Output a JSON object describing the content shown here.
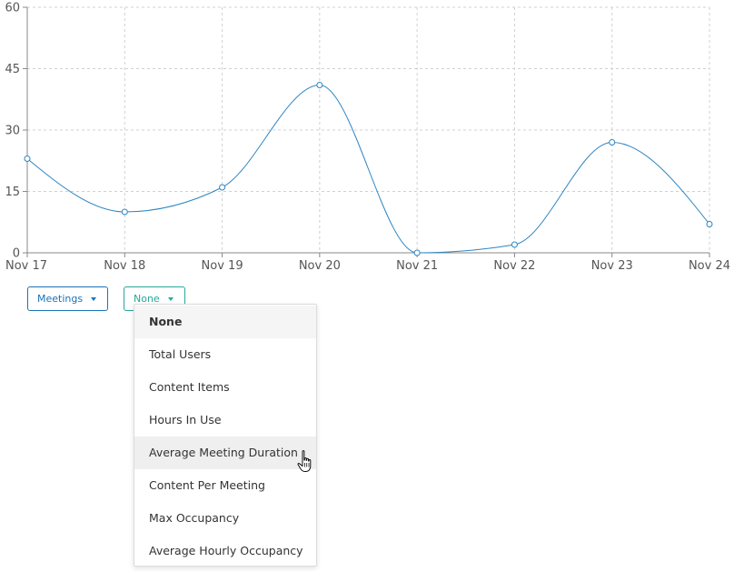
{
  "chart_data": {
    "type": "line",
    "categories": [
      "Nov 17",
      "Nov 18",
      "Nov 19",
      "Nov 20",
      "Nov 21",
      "Nov 22",
      "Nov 23",
      "Nov 24"
    ],
    "values": [
      23,
      10,
      16,
      41,
      0,
      2,
      27,
      7
    ],
    "ylim": [
      0,
      60
    ],
    "yticks": [
      "0",
      "15",
      "30",
      "45",
      "60"
    ],
    "grid": true,
    "line_color": "#2e86c1"
  },
  "controls": {
    "metric_label": "Meetings",
    "compare_label": "None"
  },
  "dropdown": {
    "items": [
      {
        "label": "None"
      },
      {
        "label": "Total Users"
      },
      {
        "label": "Content Items"
      },
      {
        "label": "Hours In Use"
      },
      {
        "label": "Average Meeting Duration"
      },
      {
        "label": "Content Per Meeting"
      },
      {
        "label": "Max Occupancy"
      },
      {
        "label": "Average Hourly Occupancy"
      }
    ]
  },
  "colors": {
    "primary": "#1a73b8",
    "accent": "#26a99a"
  },
  "icons": {
    "cursor": "hand-pointer-icon",
    "caret": "caret-down-icon"
  }
}
